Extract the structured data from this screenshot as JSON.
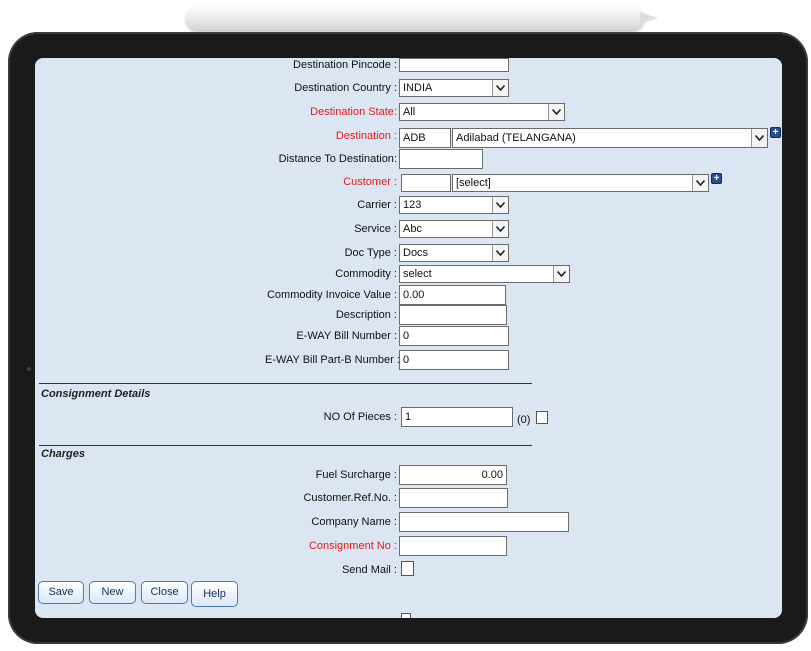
{
  "form": {
    "destination_pincode": {
      "label": "Destination Pincode",
      "value": ""
    },
    "destination_country": {
      "label": "Destination Country",
      "value": "INDIA"
    },
    "destination_state": {
      "label": "Destination State",
      "value": "All"
    },
    "destination": {
      "label": "Destination",
      "code": "ADB",
      "value": "Adilabad (TELANGANA)"
    },
    "distance_to_destination": {
      "label": "Distance To Destination",
      "value": ""
    },
    "customer": {
      "label": "Customer",
      "code": "",
      "value": "[select]"
    },
    "carrier": {
      "label": "Carrier",
      "value": "123"
    },
    "service": {
      "label": "Service",
      "value": "Abc"
    },
    "doc_type": {
      "label": "Doc Type",
      "value": "Docs"
    },
    "commodity": {
      "label": "Commodity",
      "value": "select"
    },
    "commodity_invoice_value": {
      "label": "Commodity Invoice Value",
      "value": "0.00"
    },
    "description": {
      "label": "Description",
      "value": ""
    },
    "eway_bill_number": {
      "label": "E-WAY Bill Number",
      "value": "0"
    },
    "eway_bill_partb_number": {
      "label": "E-WAY Bill Part-B Number",
      "value": "0"
    }
  },
  "consignment": {
    "section_title": "Consignment Details",
    "no_of_pieces": {
      "label": "NO Of Pieces",
      "value": "1",
      "count_note": "(0)"
    }
  },
  "charges": {
    "section_title": "Charges",
    "fuel_surcharge": {
      "label": "Fuel Surcharge",
      "value": "0.00"
    },
    "customer_ref_no": {
      "label": "Customer.Ref.No.",
      "value": ""
    },
    "company_name": {
      "label": "Company Name",
      "value": ""
    },
    "consignment_no": {
      "label": "Consignment No",
      "value": ""
    },
    "send_mail": {
      "label": "Send Mail"
    }
  },
  "buttons": {
    "save": "Save",
    "new": "New",
    "close": "Close",
    "help": "Help"
  },
  "colors": {
    "required_label": "#e21b1b",
    "screen_bg": "#dce6f2",
    "plus_button": "#2c4d8f"
  },
  "icons": {
    "dropdown": "chevron-down-icon",
    "add": "plus-icon"
  }
}
